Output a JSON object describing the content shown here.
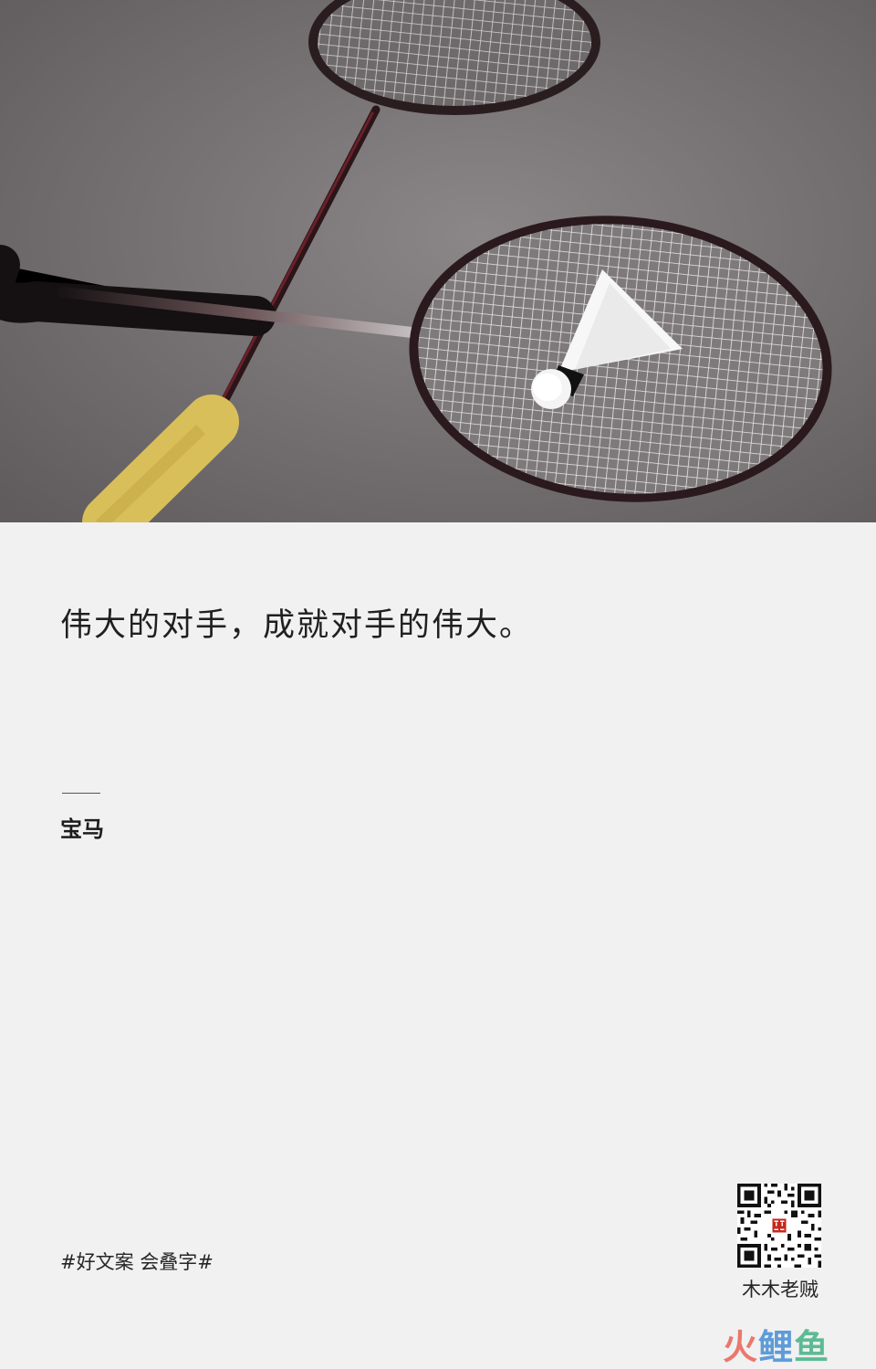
{
  "hero": {
    "image": "badminton-rackets-and-shuttlecock"
  },
  "quote": {
    "text": "伟大的对手，成就对手的伟大。"
  },
  "attribution": {
    "dash": "——",
    "brand": "宝马"
  },
  "footer": {
    "hashtags": "#好文案  会叠字#",
    "account_name": "木木老贼",
    "qr_icon": "qr-code-icon",
    "qr_center_seal": "木木老贼"
  },
  "watermark": {
    "part1": "火",
    "part2": "鲤",
    "part3": "鱼"
  },
  "colors": {
    "background": "#f1f1f1",
    "text": "#1f1f1f",
    "photo_table": "#7a7676",
    "racket_frame": "#2a1a1e",
    "handle_grip": "#d9bf5a",
    "seal_red": "#c7261d"
  }
}
